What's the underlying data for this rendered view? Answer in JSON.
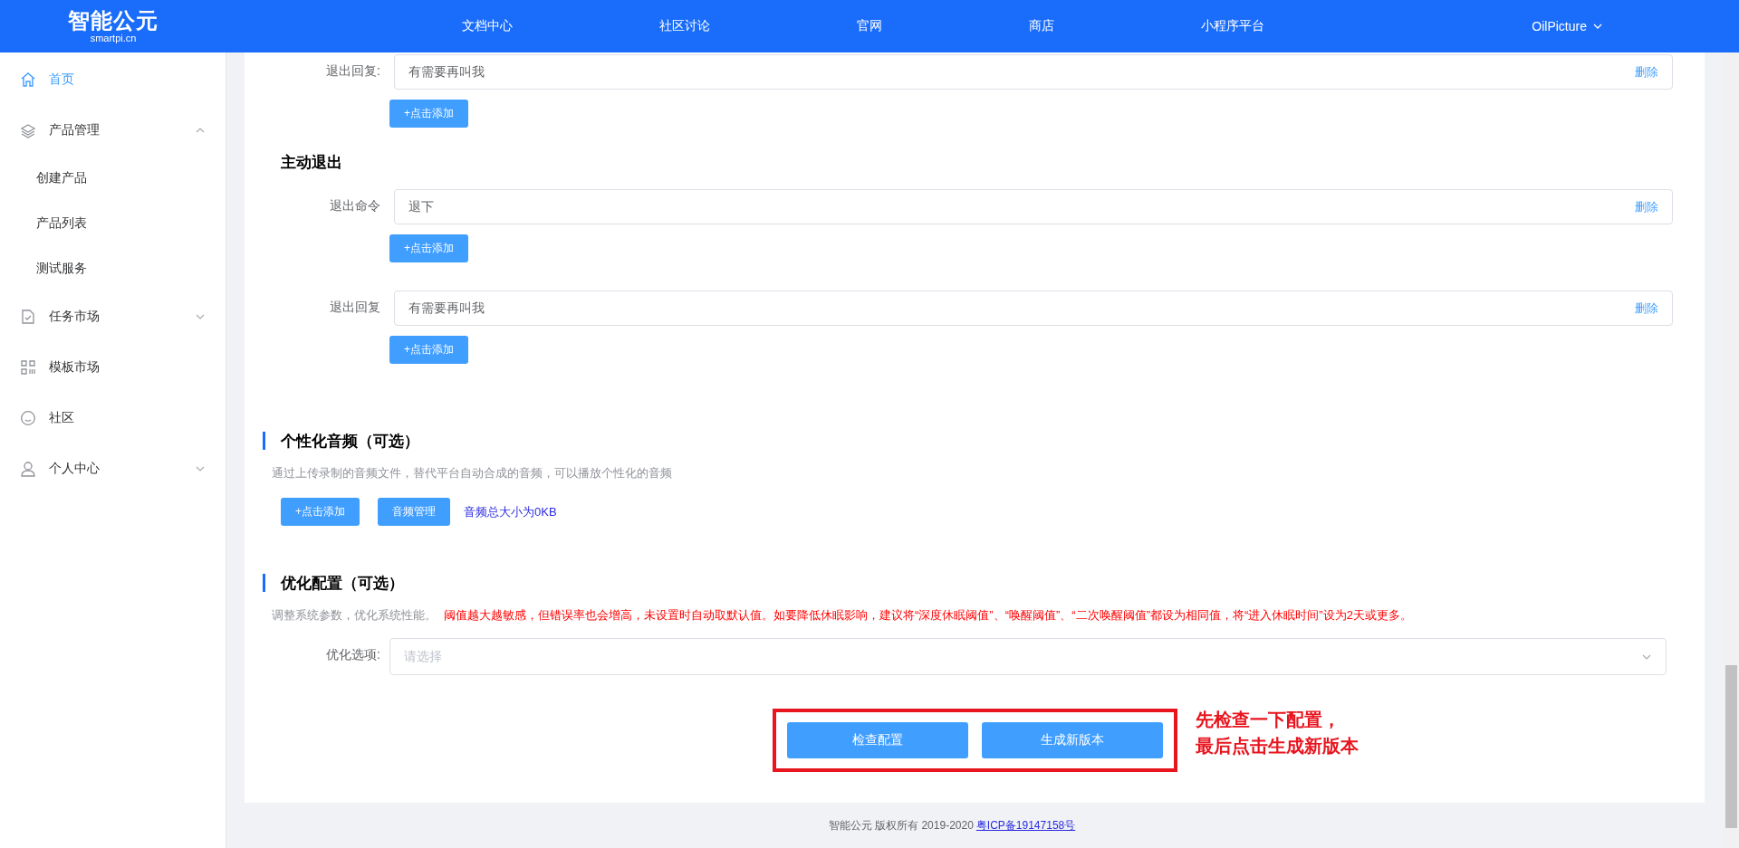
{
  "header": {
    "logo": "智能公元",
    "logo_sub": "smartpi.cn",
    "nav": [
      "文档中心",
      "社区讨论",
      "官网",
      "商店",
      "小程序平台"
    ],
    "user": "OilPicture"
  },
  "sidebar": {
    "items": [
      {
        "kind": "home",
        "label": "首页",
        "selected": true
      },
      {
        "kind": "layers",
        "label": "产品管理",
        "selected": false,
        "expanded": true,
        "children": [
          {
            "label": "创建产品",
            "selected": false
          },
          {
            "label": "产品列表",
            "selected": false
          },
          {
            "label": "测试服务",
            "selected": false
          }
        ]
      },
      {
        "kind": "task",
        "label": "任务市场",
        "selected": false,
        "expanded": false
      },
      {
        "kind": "grid",
        "label": "模板市场",
        "selected": false
      },
      {
        "kind": "smile",
        "label": "社区",
        "selected": false
      },
      {
        "kind": "user",
        "label": "个人中心",
        "selected": false,
        "expanded": false
      }
    ]
  },
  "top_row": {
    "label": "退出回复:",
    "value": "有需要再叫我",
    "delete": "删除",
    "add_button": "+点击添加"
  },
  "active_exit": {
    "title": "主动退出",
    "rows": [
      {
        "label": "退出命令",
        "value": "退下",
        "delete": "删除",
        "add_button": "+点击添加"
      },
      {
        "label": "退出回复",
        "value": "有需要再叫我",
        "delete": "删除",
        "add_button": "+点击添加"
      }
    ]
  },
  "audio": {
    "title": "个性化音频（可选）",
    "description": "通过上传录制的音频文件，替代平台自动合成的音频，可以播放个性化的音频",
    "buttons": [
      "+点击添加",
      "音频管理"
    ],
    "size_note": "音频总大小为0KB"
  },
  "optimize": {
    "title": "优化配置（可选）",
    "hint": "调整系统参数，优化系统性能。",
    "warning": "阈值越大越敏感，但错误率也会增高，未设置时自动取默认值。如要降低休眠影响，建议将“深度休眠阈值”、“唤醒阈值”、“二次唤醒阈值”都设为相同值，将“进入休眠时间”设为2天或更多。",
    "select_label": "优化选项:",
    "select_placeholder": "请选择"
  },
  "actions": {
    "buttons": [
      "检查配置",
      "生成新版本"
    ],
    "annotation": [
      "先检查一下配置，",
      "最后点击生成新版本"
    ]
  },
  "footer": {
    "copyright": "智能公元 版权所有 2019-2020",
    "icp": "粤ICP备19147158号"
  }
}
